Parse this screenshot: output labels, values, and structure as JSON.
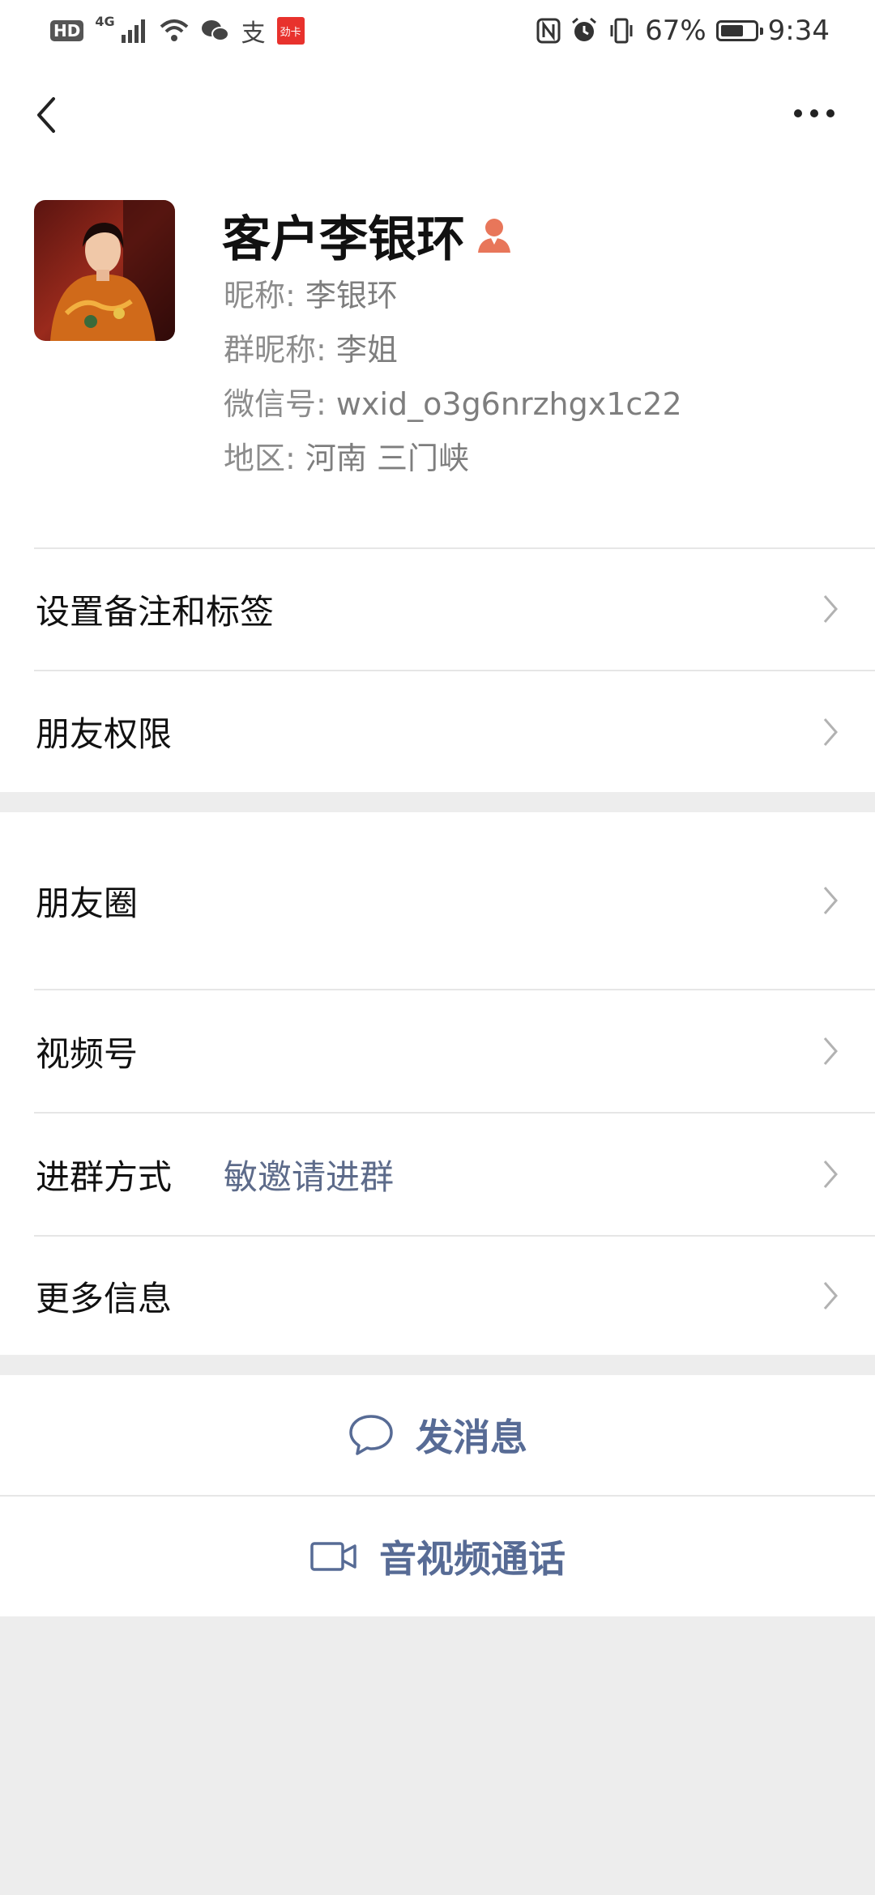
{
  "status_bar": {
    "hd": "HD",
    "network": "4G",
    "support_glyph": "支",
    "red_app": "劲卡",
    "battery_percent": "67%",
    "battery_level": 0.67,
    "time": "9:34",
    "icons": [
      "signal-icon",
      "wifi-icon",
      "wechat-icon",
      "nfc-icon",
      "alarm-icon",
      "vibrate-icon",
      "battery-icon"
    ]
  },
  "header": {
    "display_name": "客户李银环",
    "nickname_label": "昵称: ",
    "nickname": "李银环",
    "group_nick_label": "群昵称: ",
    "group_nick": "李姐",
    "wechat_id_label": "微信号: ",
    "wechat_id": "wxid_o3g6nrzhgx1c22",
    "region_label": "地区: ",
    "region": "河南  三门峡"
  },
  "settings": {
    "remark_tags": "设置备注和标签",
    "friend_permissions": "朋友权限"
  },
  "details": {
    "moments": "朋友圈",
    "channels": "视频号",
    "join_method_label": "进群方式",
    "join_method_value": "敏邀请进群",
    "more_info": "更多信息"
  },
  "actions": {
    "send_message": "发消息",
    "av_call": "音视频通话"
  },
  "colors": {
    "link": "#576b95",
    "secondary_text": "#7e7e7e",
    "background": "#ededed",
    "person_badge": "#e8765a"
  }
}
